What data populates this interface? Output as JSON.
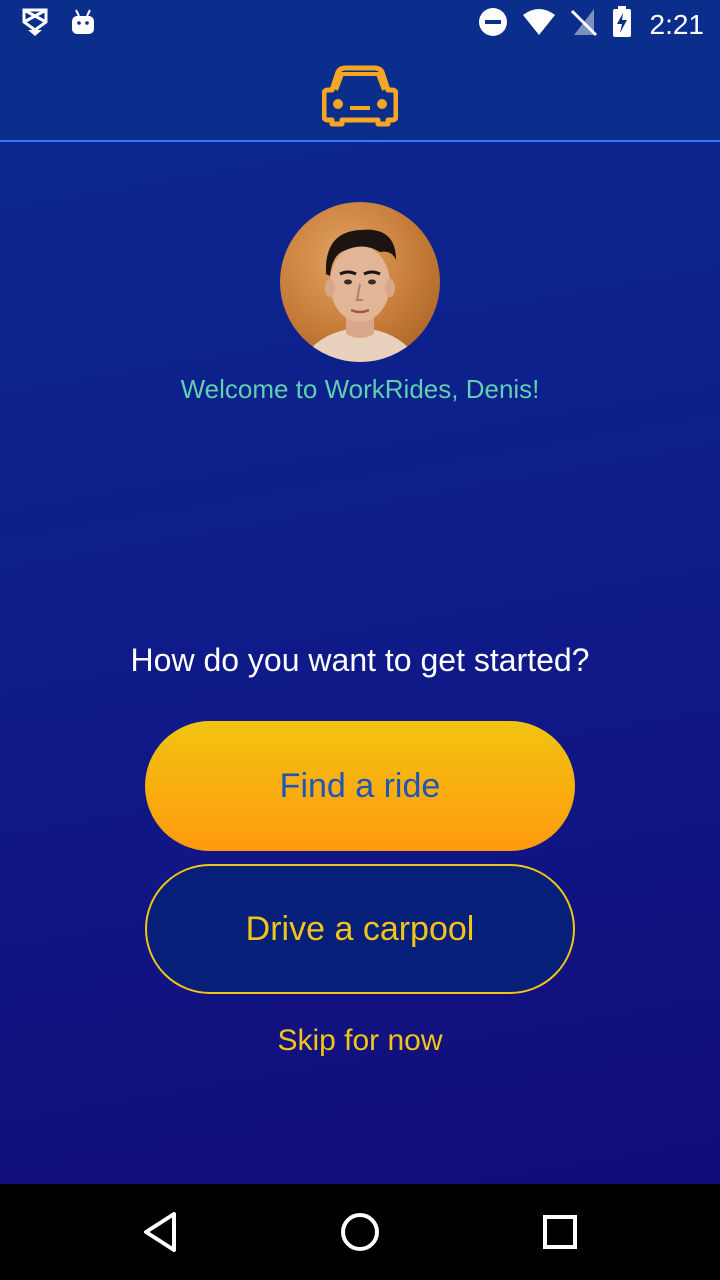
{
  "status_bar": {
    "time": "2:21",
    "left_icons": [
      "notification-icon",
      "android-icon"
    ],
    "right_icons": [
      "do-not-disturb-icon",
      "wifi-icon",
      "no-sim-icon",
      "battery-charging-icon"
    ]
  },
  "app_bar": {
    "logo_icon": "car-icon",
    "accent_color": "#f5a623"
  },
  "profile": {
    "avatar_icon": "avatar",
    "welcome_text": "Welcome to WorkRides, Denis!"
  },
  "onboarding": {
    "question": "How do you want to get started?",
    "find_ride_label": "Find a ride",
    "drive_carpool_label": "Drive a carpool",
    "skip_label": "Skip for now"
  },
  "colors": {
    "primary_bg": "#0b2d8c",
    "accent_yellow": "#f2c318",
    "accent_orange": "#ff9a0e",
    "welcome_text": "#5ed0b0"
  },
  "nav_bar": {
    "icons": [
      "back-icon",
      "home-icon",
      "recents-icon"
    ]
  }
}
